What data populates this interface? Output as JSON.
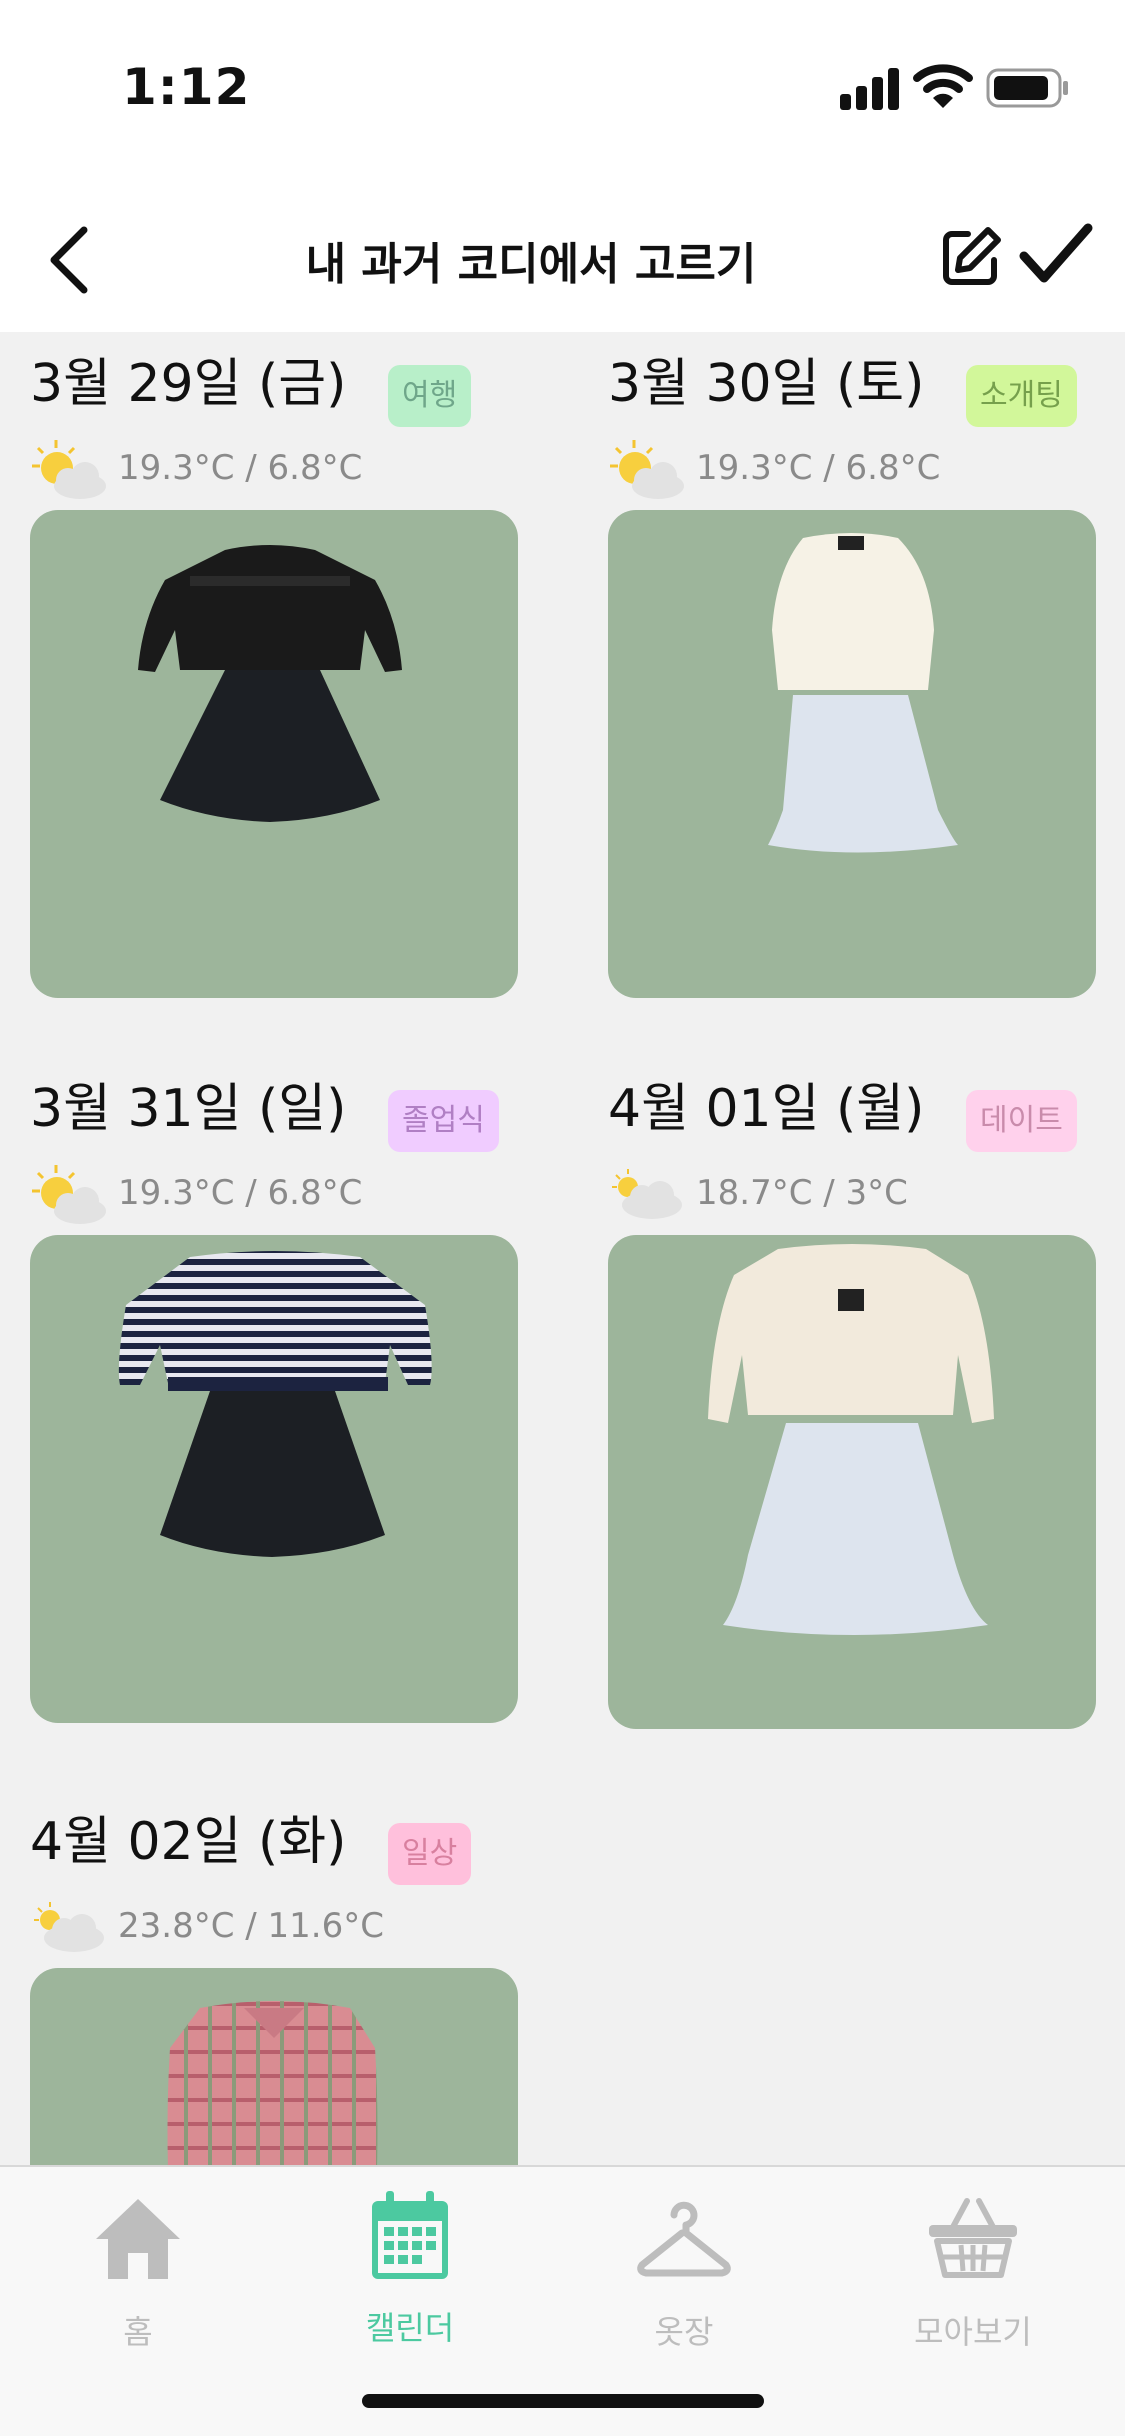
{
  "status_bar": {
    "time": "1:12"
  },
  "header": {
    "title": "내 과거 코디에서 고르기"
  },
  "colors": {
    "accent": "#4cc9a0",
    "photo_bg": "#9db59b",
    "tag_travel": "#b8efc9",
    "tag_blind_date": "#d2f79a",
    "tag_graduation": "#f0ccff",
    "tag_date": "#ffd1ec",
    "tag_daily": "#ffc0dc"
  },
  "cards": [
    {
      "date": "3월 29일 (금)",
      "tag": "여행",
      "weather_icon": "sun-cloud-icon",
      "temp": "19.3°C / 6.8°C"
    },
    {
      "date": "3월 30일 (토)",
      "tag": "소개팅",
      "weather_icon": "sun-cloud-icon",
      "temp": "19.3°C / 6.8°C"
    },
    {
      "date": "3월 31일 (일)",
      "tag": "졸업식",
      "weather_icon": "sun-cloud-icon",
      "temp": "19.3°C / 6.8°C"
    },
    {
      "date": "4월 01일 (월)",
      "tag": "데이트",
      "weather_icon": "cloud-sun-small-icon",
      "temp": "18.7°C / 3°C"
    },
    {
      "date": "4월 02일 (화)",
      "tag": "일상",
      "weather_icon": "cloud-sun-small-icon",
      "temp": "23.8°C / 11.6°C"
    }
  ],
  "tabbar": {
    "items": [
      {
        "label": "홈",
        "icon": "home-icon"
      },
      {
        "label": "캘린더",
        "icon": "calendar-icon"
      },
      {
        "label": "옷장",
        "icon": "hanger-icon"
      },
      {
        "label": "모아보기",
        "icon": "basket-icon"
      }
    ]
  }
}
